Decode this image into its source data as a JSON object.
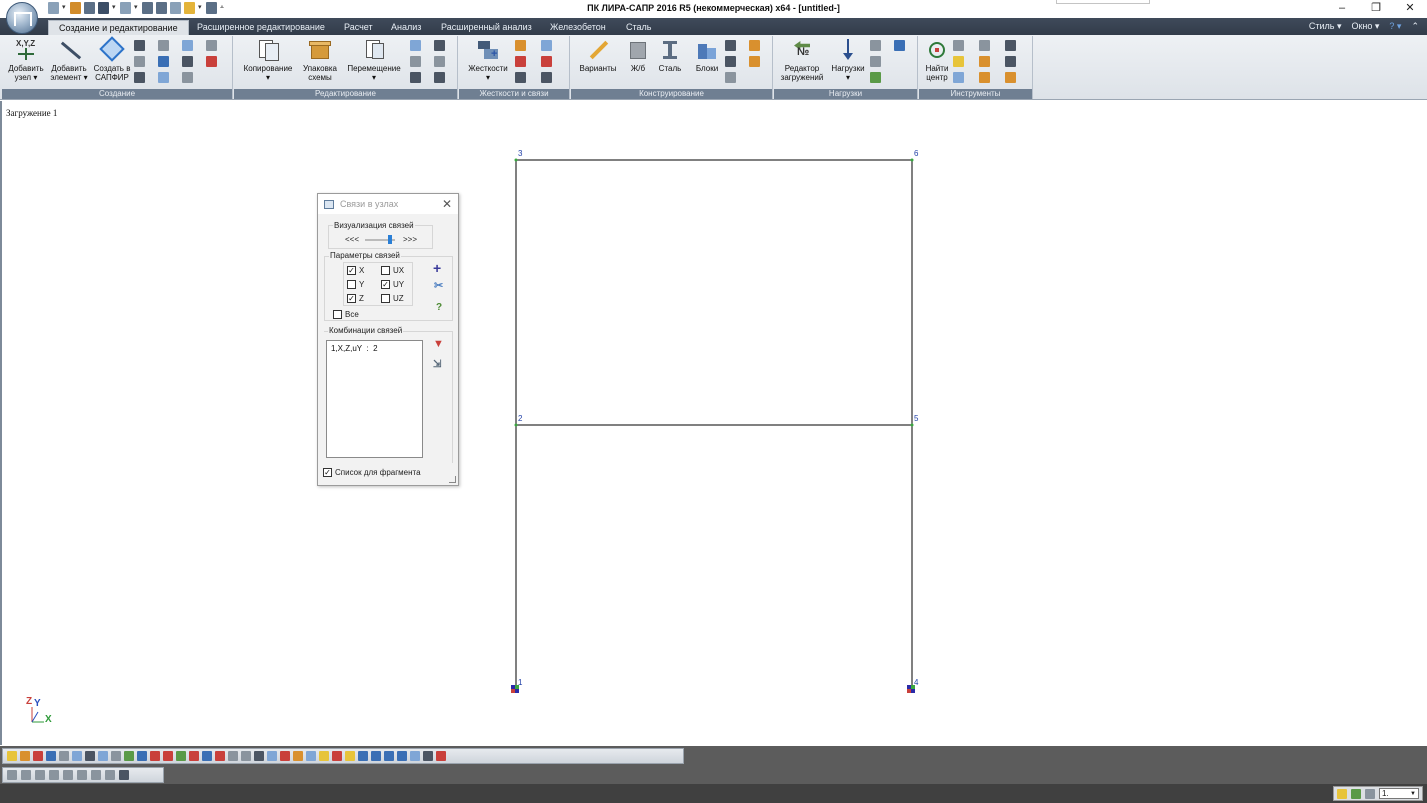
{
  "window": {
    "title": "ПК ЛИРА-САПР  2016 R5 (некоммерческая) x64 - [untitled-]",
    "controls": {
      "minimize": "–",
      "restore": "❐",
      "close": "✕"
    }
  },
  "tabs": [
    {
      "label": "Создание и редактирование",
      "active": true
    },
    {
      "label": "Расширенное редактирование"
    },
    {
      "label": "Расчет"
    },
    {
      "label": "Анализ"
    },
    {
      "label": "Расширенный анализ"
    },
    {
      "label": "Железобетон"
    },
    {
      "label": "Сталь"
    }
  ],
  "right_menu": {
    "style": "Стиль",
    "window": "Окно"
  },
  "ribbon": {
    "groups": [
      {
        "label": "Создание",
        "buttons": [
          "Добавить узел",
          "Добавить элемент",
          "Создать в САПФИР"
        ]
      },
      {
        "label": "Редактирование",
        "buttons": [
          "Копирование",
          "Упаковка схемы",
          "Перемещение"
        ]
      },
      {
        "label": "Жесткости и связи",
        "buttons": [
          "Жесткости"
        ]
      },
      {
        "label": "Конструирование",
        "buttons": [
          "Варианты",
          "Ж/б",
          "Сталь",
          "Блоки"
        ]
      },
      {
        "label": "Нагрузки",
        "buttons": [
          "Редактор загружений",
          "Нагрузки"
        ]
      },
      {
        "label": "Инструменты",
        "buttons": [
          "Найти центр"
        ]
      }
    ],
    "b": {
      "add_node_1": "Добавить",
      "add_node_2": "узел",
      "add_elem_1": "Добавить",
      "add_elem_2": "элемент",
      "sapfir_1": "Создать в",
      "sapfir_2": "САПФИР",
      "copy": "Копирование",
      "pack_1": "Упаковка",
      "pack_2": "схемы",
      "move": "Перемещение",
      "stiff": "Жесткости",
      "variants": "Варианты",
      "rc": "Ж/б",
      "steel": "Сталь",
      "blocks": "Блоки",
      "loadeditor_1": "Редактор",
      "loadeditor_2": "загружений",
      "loads": "Нагрузки",
      "center_1": "Найти",
      "center_2": "центр",
      "xyz": "X,Y,Z",
      "no_icon": "№"
    }
  },
  "workarea": {
    "loadcase": "Загружение 1",
    "nodes": [
      {
        "id": "1"
      },
      {
        "id": "2"
      },
      {
        "id": "3"
      },
      {
        "id": "4"
      },
      {
        "id": "5"
      },
      {
        "id": "6"
      }
    ]
  },
  "dialog": {
    "title": "Связи в узлах",
    "visualization": {
      "legend": "Визуализация связей",
      "left": "<<<",
      "right": ">>>"
    },
    "params": {
      "legend": "Параметры связей",
      "x": {
        "label": "X",
        "checked": true
      },
      "y": {
        "label": "Y",
        "checked": false
      },
      "z": {
        "label": "Z",
        "checked": true
      },
      "ux": {
        "label": "UX",
        "checked": false
      },
      "uy": {
        "label": "UY",
        "checked": true
      },
      "uz": {
        "label": "UZ",
        "checked": false
      },
      "all": {
        "label": "Все",
        "checked": false
      }
    },
    "combinations": {
      "legend": "Комбинации связей",
      "items": [
        "1,X,Z,uY  :  2"
      ]
    },
    "fragment": {
      "label": "Список для фрагмента",
      "checked": true
    }
  },
  "axis": {
    "z": "Z",
    "y": "Y",
    "x": "X"
  },
  "status": {
    "zoom": "1."
  },
  "colors": {
    "tab_bg": "#3f4a5a",
    "frame": "#000000",
    "node_label": "#2342a8",
    "node_dot": "#3aa640"
  }
}
